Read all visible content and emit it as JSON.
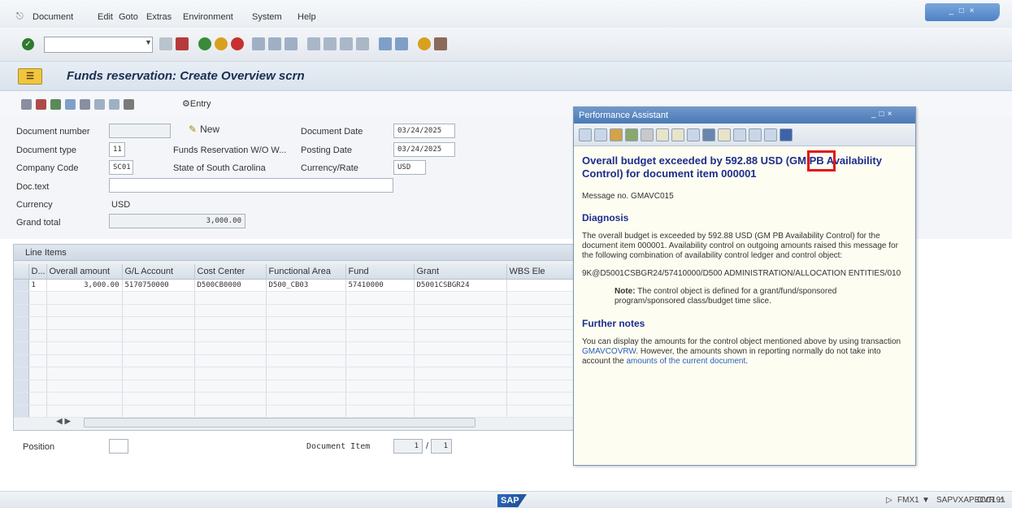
{
  "menubar": {
    "items": [
      "Document",
      "Edit",
      "Goto",
      "Extras",
      "Environment",
      "System",
      "Help"
    ]
  },
  "title": "Funds reservation: Create Overview scrn",
  "app_toolbar": {
    "entry_label": "Entry"
  },
  "form": {
    "doc_number_label": "Document number",
    "new_label": "New",
    "doc_date_label": "Document Date",
    "doc_date_value": "03/24/2025",
    "doc_type_label": "Document type",
    "doc_type_value": "11",
    "doc_type_desc": "Funds Reservation W/O W...",
    "posting_date_label": "Posting Date",
    "posting_date_value": "03/24/2025",
    "company_code_label": "Company Code",
    "company_code_value": "SC01",
    "company_name": "State of South Carolina",
    "currency_rate_label": "Currency/Rate",
    "currency_rate_value": "USD",
    "doc_text_label": "Doc.text",
    "currency_label": "Currency",
    "currency_value": "USD",
    "grand_total_label": "Grand total",
    "grand_total_value": "3,000.00"
  },
  "line_items": {
    "title": "Line Items",
    "columns": [
      "D...",
      "Overall amount",
      "G/L Account",
      "Cost Center",
      "Functional Area",
      "Fund",
      "Grant",
      "WBS Ele"
    ],
    "rows": [
      [
        "1",
        "3,000.00",
        "5170750000",
        "D500CB0000",
        "D500_CB03",
        "57410000",
        "D5001CSBGR24",
        ""
      ]
    ]
  },
  "bottom": {
    "position_label": "Position",
    "doc_item_label": "Document Item",
    "doc_item_current": "1",
    "doc_item_sep": "/",
    "doc_item_total": "1"
  },
  "statusbar": {
    "sap_logo": "SAP",
    "system": "FMX1",
    "server": "SAPVXAPECC191",
    "mode": "OVR"
  },
  "perf_assistant": {
    "title": "Performance Assistant",
    "heading": "Overall budget exceeded by 592.88 USD (GM PB Availability Control) for document item 000001",
    "message_no": "Message no. GMAVC015",
    "diagnosis_heading": "Diagnosis",
    "diagnosis_text": "The overall budget is exceeded by 592.88 USD (GM PB Availability Control) for the document item 000001. Availability control on outgoing amounts raised this message for the following combination of availability control ledger and control object:",
    "control_object": "9K@D5001CSBGR24/57410000/D500 ADMINISTRATION/ALLOCATION ENTITIES/010",
    "note_label": "Note:",
    "note_text": " The control object is defined for a grant/fund/sponsored program/sponsored class/budget time slice.",
    "further_heading": "Further notes",
    "further_text_1": "You can display the amounts for the control object mentioned above by using transaction ",
    "further_link_1": "GMAVCOVRW",
    "further_text_2": ". However, the amounts shown in reporting normally do not take into account the ",
    "further_link_2": "amounts of the current document",
    "further_text_3": "."
  },
  "colors": {
    "title": "#1b2d52",
    "pa_heading": "#1d2d8c",
    "highlight": "#e01818",
    "link": "#2a5fbf"
  }
}
